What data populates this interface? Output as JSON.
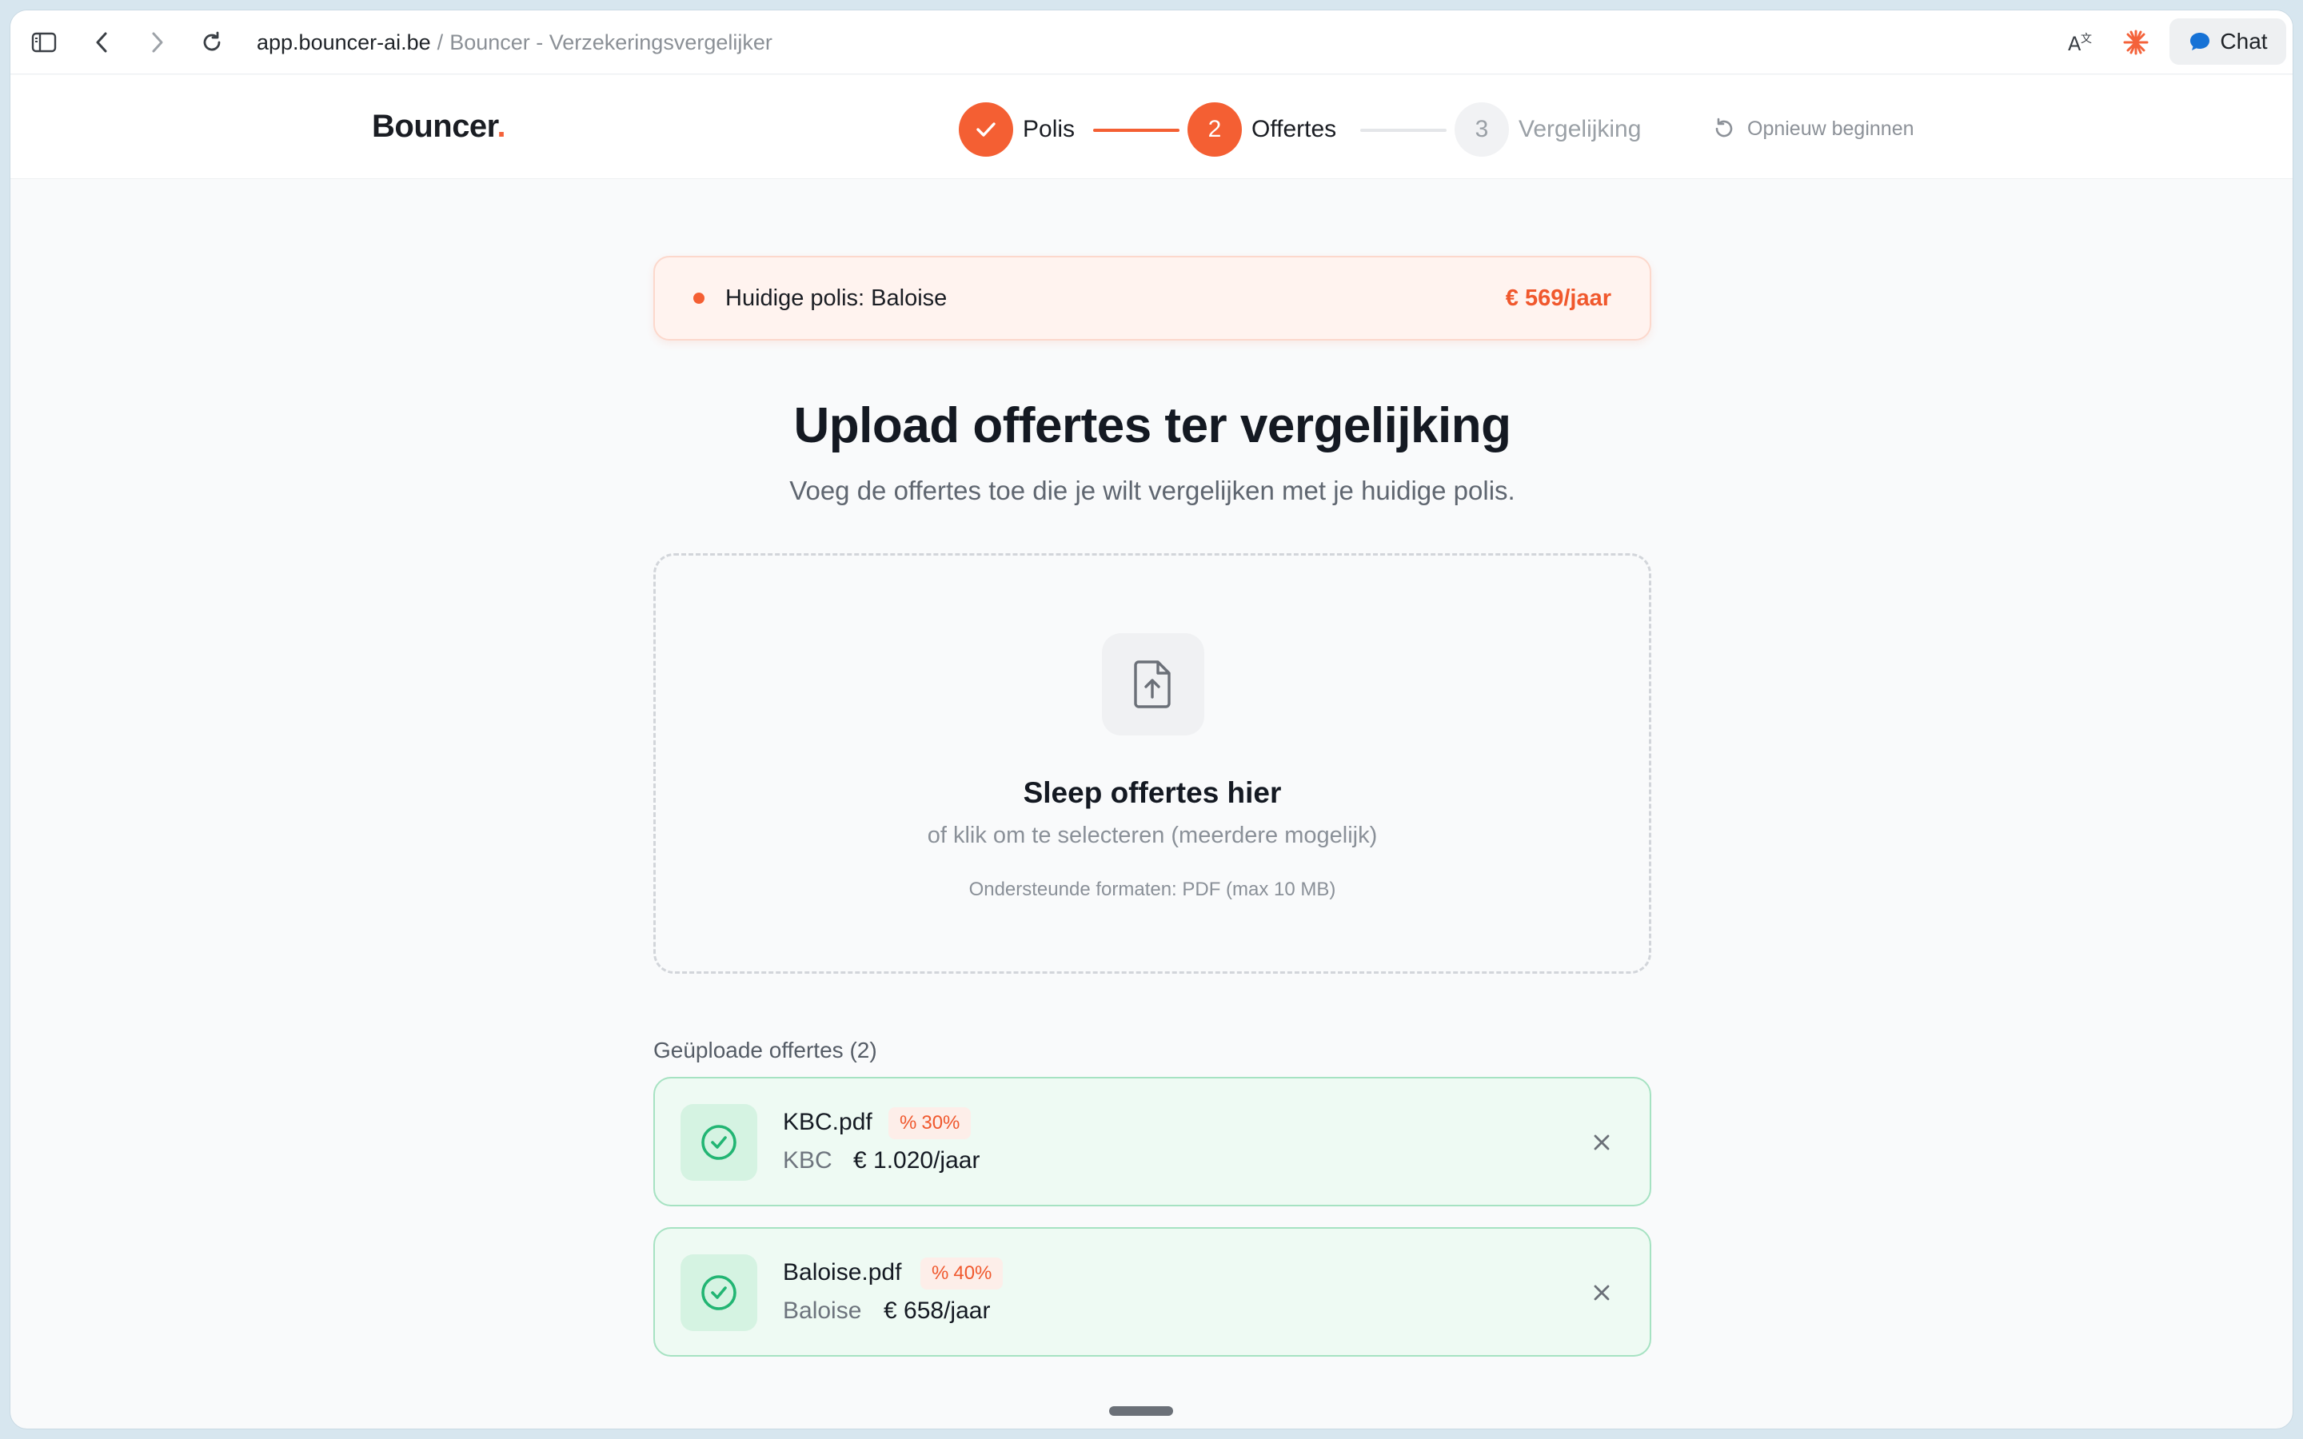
{
  "browser": {
    "host": "app.bouncer-ai.be",
    "separator": "/",
    "page_title": "Bouncer - Verzekeringsvergelijker",
    "chat_label": "Chat",
    "icons": [
      "sidebar-icon",
      "back-icon",
      "forward-icon",
      "reload-icon",
      "translate-icon",
      "sparkle-icon",
      "chat-bubble-icon"
    ]
  },
  "header": {
    "logo_text": "Bouncer",
    "logo_dot": ".",
    "steps": [
      {
        "number": "1",
        "label": "Polis",
        "state": "done"
      },
      {
        "number": "2",
        "label": "Offertes",
        "state": "active"
      },
      {
        "number": "3",
        "label": "Vergelijking",
        "state": "pending"
      }
    ],
    "restart_label": "Opnieuw beginnen"
  },
  "current_policy": {
    "label": "Huidige polis: Baloise",
    "price": "€ 569/jaar"
  },
  "main": {
    "title": "Upload offertes ter vergelijking",
    "subtitle": "Voeg de offertes toe die je wilt vergelijken met je huidige polis."
  },
  "dropzone": {
    "title": "Sleep offertes hier",
    "subtitle": "of klik om te selecteren (meerdere mogelijk)",
    "formats": "Ondersteunde formaten: PDF (max 10 MB)"
  },
  "uploaded": {
    "title": "Geüploade offertes (2)",
    "files": [
      {
        "filename": "KBC.pdf",
        "badge": "30%",
        "insurer": "KBC",
        "price": "€ 1.020/jaar"
      },
      {
        "filename": "Baloise.pdf",
        "badge": "40%",
        "insurer": "Baloise",
        "price": "€ 658/jaar"
      }
    ]
  },
  "colors": {
    "accent": "#f45f33",
    "success": "#22b573",
    "success_bg": "#eefaf3",
    "text": "#141922"
  }
}
